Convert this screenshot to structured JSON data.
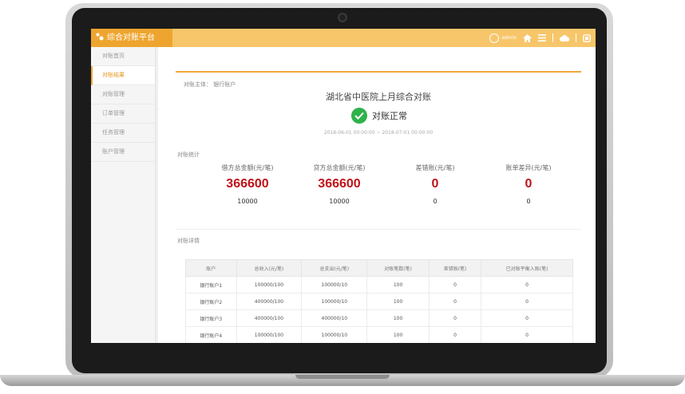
{
  "app": {
    "brand": "综合对账平台",
    "user_name": "admin"
  },
  "colors": {
    "accent": "#f0a93b",
    "topbar": "#f7c66a",
    "success": "#2fb24a",
    "highlight": "#c0121a"
  },
  "icons": [
    "user-avatar-icon",
    "home-icon",
    "menu-icon",
    "cloud-icon",
    "exit-icon"
  ],
  "sidebar": {
    "items": [
      {
        "label": "对账首页"
      },
      {
        "label": "对账结果"
      },
      {
        "label": "对账管理"
      },
      {
        "label": "订单管理"
      },
      {
        "label": "任务管理"
      },
      {
        "label": "账户管理"
      }
    ]
  },
  "summary": {
    "subject": "对账主体：  银行账户",
    "title": "湖北省中医院上月综合对账",
    "status": "对账正常",
    "period": "2018-06-01 00:00:00 ~ 2018-07-01 00:00:00"
  },
  "stats": {
    "section_label": "对账统计",
    "items": [
      {
        "header": "借方总金额(元/笔)",
        "amount": "366600",
        "count": "10000"
      },
      {
        "header": "贷方总金额(元/笔)",
        "amount": "366600",
        "count": "10000"
      },
      {
        "header": "差错账(元/笔)",
        "amount": "0",
        "count": "0"
      },
      {
        "header": "账单差异(元/笔)",
        "amount": "0",
        "count": "0"
      }
    ]
  },
  "details": {
    "section_label": "对账详情",
    "columns": [
      "账户",
      "总收入(元/笔)",
      "总支出(元/笔)",
      "对账笔数(笔)",
      "差错账(笔)",
      "已对账平衡入账(笔)"
    ],
    "rows": [
      [
        "银行账户1",
        "100000/100",
        "100000/10",
        "100",
        "0",
        "0"
      ],
      [
        "银行账户2",
        "400000/100",
        "100000/10",
        "100",
        "0",
        "0"
      ],
      [
        "银行账户3",
        "400000/100",
        "400000/10",
        "100",
        "0",
        "0"
      ],
      [
        "银行账户4",
        "100000/100",
        "100000/10",
        "100",
        "0",
        "0"
      ]
    ]
  }
}
